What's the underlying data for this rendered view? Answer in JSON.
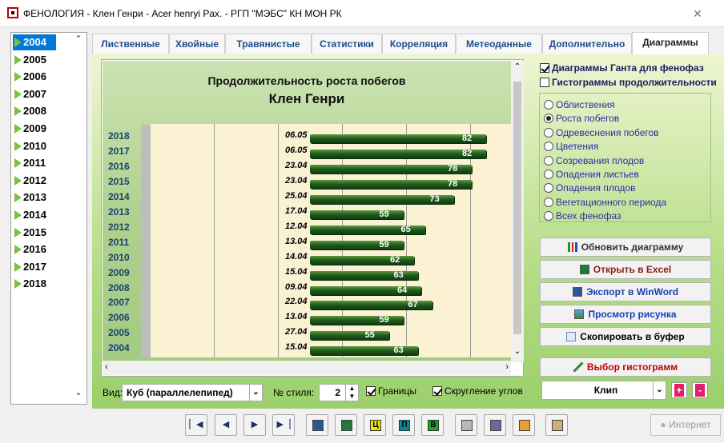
{
  "window": {
    "title": "ФЕНОЛОГИЯ - Клен Генри - Acer henryi Pax. - РГП \"МЭБС\" КН МОН РК",
    "close": "✕"
  },
  "years": [
    "2004",
    "2005",
    "2006",
    "2007",
    "2008",
    "2009",
    "2010",
    "2011",
    "2012",
    "2013",
    "2014",
    "2015",
    "2016",
    "2017",
    "2018"
  ],
  "tabs": [
    "Лиственные",
    "Хвойные",
    "Травянистые",
    "Статистики",
    "Корреляция",
    "Метеоданные",
    "Дополнительно",
    "Диаграммы"
  ],
  "chart_data": {
    "type": "bar",
    "title": "Продолжительность роста побегов",
    "subtitle": "Клен Генри",
    "categories": [
      "2018",
      "2017",
      "2016",
      "2015",
      "2014",
      "2013",
      "2012",
      "2011",
      "2010",
      "2009",
      "2008",
      "2007",
      "2006",
      "2005",
      "2004"
    ],
    "start_labels": [
      "06.05",
      "06.05",
      "23.04",
      "23.04",
      "25.04",
      "17.04",
      "12.04",
      "13.04",
      "14.04",
      "15.04",
      "09.04",
      "22.04",
      "13.04",
      "27.04",
      "15.04"
    ],
    "values": [
      82,
      82,
      78,
      78,
      73,
      59,
      65,
      59,
      62,
      63,
      64,
      67,
      59,
      55,
      63
    ]
  },
  "options": {
    "gantt": "Диаграммы Ганта для фенофаз",
    "hist": "Гистограммы продолжительности",
    "radios": [
      "Облиствения",
      "Роста побегов",
      "Одревеснения побегов",
      "Цветения",
      "Созревания плодов",
      "Опадения листьев",
      "Опадения плодов",
      "Вегетационного периода",
      "Всех фенофаз"
    ],
    "selected": "Роста побегов"
  },
  "actions": {
    "refresh": "Обновить диаграмму",
    "excel": "Открыть в Excel",
    "word": "Экспорт в WinWord",
    "view": "Просмотр рисунка",
    "copy": "Скопировать в буфер",
    "hist": "Выбор гистограмм"
  },
  "bottom": {
    "view_label": "Вид:",
    "view_value": "Куб (параллелепипед)",
    "style_label": "№ стиля:",
    "style_value": "2",
    "borders": "Границы",
    "rounding": "Скругление углов",
    "clip": "Клип",
    "plus": "+",
    "minus": "-"
  },
  "internet": "Интернет",
  "nav": {
    "c": "Ц",
    "p": "П",
    "v": "В"
  },
  "colors": {
    "accent": "#0078d7",
    "bar": "#1e5a1c",
    "years": "#1a3f74",
    "radio": "#2a2ea8"
  }
}
